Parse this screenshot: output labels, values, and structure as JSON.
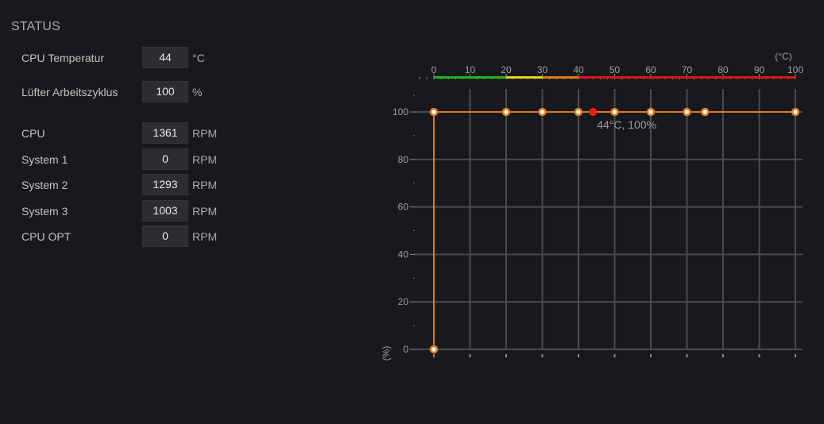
{
  "status": {
    "title": "STATUS",
    "cpu_temp": {
      "label": "CPU Temperatur",
      "value": "44",
      "unit": "°C"
    },
    "fan_duty": {
      "label": "Lüfter Arbeitszyklus",
      "value": "100",
      "unit": "%"
    },
    "fans": [
      {
        "label": "CPU",
        "value": "1361",
        "unit": "RPM"
      },
      {
        "label": "System 1",
        "value": "0",
        "unit": "RPM"
      },
      {
        "label": "System 2",
        "value": "1293",
        "unit": "RPM"
      },
      {
        "label": "System 3",
        "value": "1003",
        "unit": "RPM"
      },
      {
        "label": "CPU OPT",
        "value": "0",
        "unit": "RPM"
      }
    ]
  },
  "chart_data": {
    "type": "line",
    "xlabel": "(°C)",
    "ylabel": "(%)",
    "xlim": [
      0,
      100
    ],
    "ylim": [
      0,
      100
    ],
    "x_ticks": [
      0,
      10,
      20,
      30,
      40,
      50,
      60,
      70,
      80,
      90,
      100
    ],
    "y_ticks": [
      0,
      20,
      40,
      60,
      80,
      100
    ],
    "grid": true,
    "series": [
      {
        "x": [
          0,
          0,
          20,
          30,
          40,
          50,
          60,
          70,
          75,
          100
        ],
        "y": [
          0,
          100,
          100,
          100,
          100,
          100,
          100,
          100,
          100,
          100
        ]
      }
    ],
    "temperature_bands": [
      {
        "from": 0,
        "to": 20,
        "color": "#1fb51f"
      },
      {
        "from": 20,
        "to": 30,
        "color": "#e8d21a"
      },
      {
        "from": 30,
        "to": 40,
        "color": "#e07a17"
      },
      {
        "from": 40,
        "to": 100,
        "color": "#d81717"
      }
    ],
    "current_point": {
      "x": 44,
      "y": 100,
      "label": "44°C, 100%"
    },
    "colors": {
      "line": "#e07a17",
      "current": "#ff1a1a",
      "grid": "#4a4b4f"
    }
  }
}
